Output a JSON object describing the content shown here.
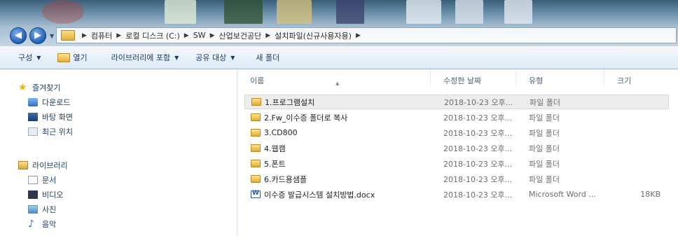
{
  "address": {
    "crumbs": [
      "컴퓨터",
      "로컬 디스크 (C:)",
      "SW",
      "산업보건공단",
      "설치파일(신규사용자용)"
    ]
  },
  "toolbar": {
    "organize": "구성",
    "open": "열기",
    "include_library": "라이브러리에 포함",
    "share_with": "공유 대상",
    "new_folder": "새 폴더"
  },
  "navpane": {
    "favorites": {
      "label": "즐겨찾기",
      "items": [
        "다운로드",
        "바탕 화면",
        "최근 위치"
      ]
    },
    "libraries": {
      "label": "라이브러리",
      "items": [
        "문서",
        "비디오",
        "사진",
        "음악"
      ]
    }
  },
  "columns": {
    "name": "이름",
    "date": "수정한 날짜",
    "type": "유형",
    "size": "크기"
  },
  "files": [
    {
      "name": "1.프로그램설치",
      "date": "2018-10-23 오후...",
      "type": "파일 폴더",
      "size": "",
      "kind": "folder"
    },
    {
      "name": "2.Fw_이수증 폴더로 복사",
      "date": "2018-10-23 오후...",
      "type": "파일 폴더",
      "size": "",
      "kind": "folder"
    },
    {
      "name": "3.CD800",
      "date": "2018-10-23 오후...",
      "type": "파일 폴더",
      "size": "",
      "kind": "folder"
    },
    {
      "name": "4.웹캠",
      "date": "2018-10-23 오후...",
      "type": "파일 폴더",
      "size": "",
      "kind": "folder"
    },
    {
      "name": "5.폰트",
      "date": "2018-10-23 오후...",
      "type": "파일 폴더",
      "size": "",
      "kind": "folder"
    },
    {
      "name": "6.카드용샘플",
      "date": "2018-10-23 오후...",
      "type": "파일 폴더",
      "size": "",
      "kind": "folder"
    },
    {
      "name": "이수증 발급시스템 설치방법.docx",
      "date": "2018-10-23 오후...",
      "type": "Microsoft Word ...",
      "size": "18KB",
      "kind": "word"
    }
  ],
  "colors": {
    "accent": "#1e395b",
    "selection": "#ededed",
    "folder": "#e3b23d"
  }
}
